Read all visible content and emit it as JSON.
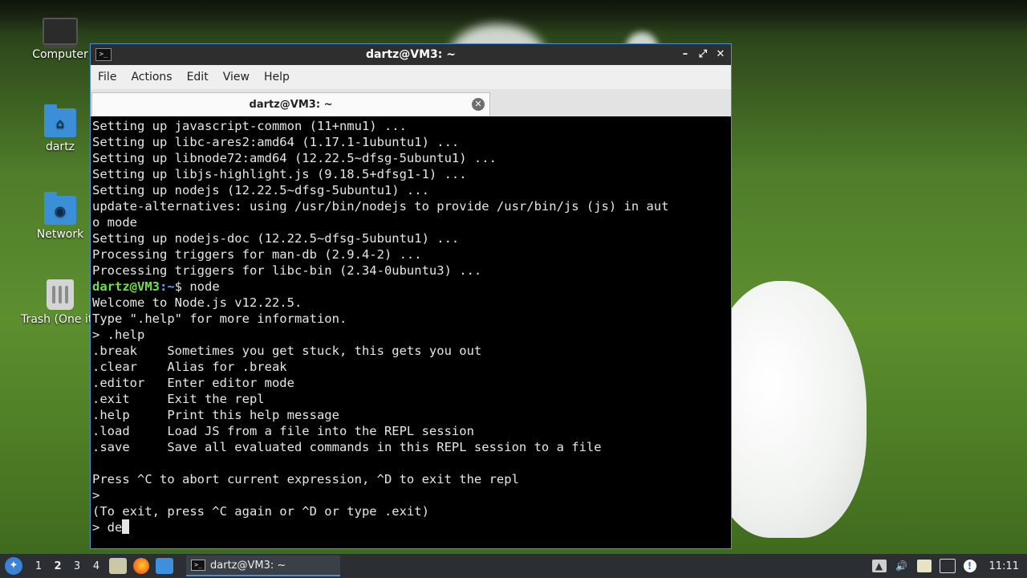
{
  "desktop": {
    "icons": [
      {
        "label": "Computer"
      },
      {
        "label": "dartz"
      },
      {
        "label": "Network"
      },
      {
        "label": "Trash (One ite"
      }
    ]
  },
  "window": {
    "title": "dartz@VM3: ~",
    "menu": [
      "File",
      "Actions",
      "Edit",
      "View",
      "Help"
    ],
    "tab_title": "dartz@VM3: ~",
    "controls": {
      "minimize": "–",
      "maximize": "⤢",
      "close": "✕"
    }
  },
  "terminal": {
    "lines_top": [
      "Setting up javascript-common (11+nmu1) ...",
      "Setting up libc-ares2:amd64 (1.17.1-1ubuntu1) ...",
      "Setting up libnode72:amd64 (12.22.5~dfsg-5ubuntu1) ...",
      "Setting up libjs-highlight.js (9.18.5+dfsg1-1) ...",
      "Setting up nodejs (12.22.5~dfsg-5ubuntu1) ...",
      "update-alternatives: using /usr/bin/nodejs to provide /usr/bin/js (js) in aut",
      "o mode",
      "Setting up nodejs-doc (12.22.5~dfsg-5ubuntu1) ...",
      "Processing triggers for man-db (2.9.4-2) ...",
      "Processing triggers for libc-bin (2.34-0ubuntu3) ..."
    ],
    "prompt_user": "dartz@VM3",
    "prompt_path": ":~",
    "prompt_cmd": "$ node",
    "lines_bottom": [
      "Welcome to Node.js v12.22.5.",
      "Type \".help\" for more information.",
      "> .help",
      ".break    Sometimes you get stuck, this gets you out",
      ".clear    Alias for .break",
      ".editor   Enter editor mode",
      ".exit     Exit the repl",
      ".help     Print this help message",
      ".load     Load JS from a file into the REPL session",
      ".save     Save all evaluated commands in this REPL session to a file",
      "",
      "Press ^C to abort current expression, ^D to exit the repl",
      ">",
      "(To exit, press ^C again or ^D or type .exit)"
    ],
    "current_input": "> de"
  },
  "taskbar": {
    "workspaces": [
      "1",
      "2",
      "3",
      "4"
    ],
    "active_workspace": "2",
    "task_label": "dartz@VM3: ~",
    "clock": "11:11"
  }
}
